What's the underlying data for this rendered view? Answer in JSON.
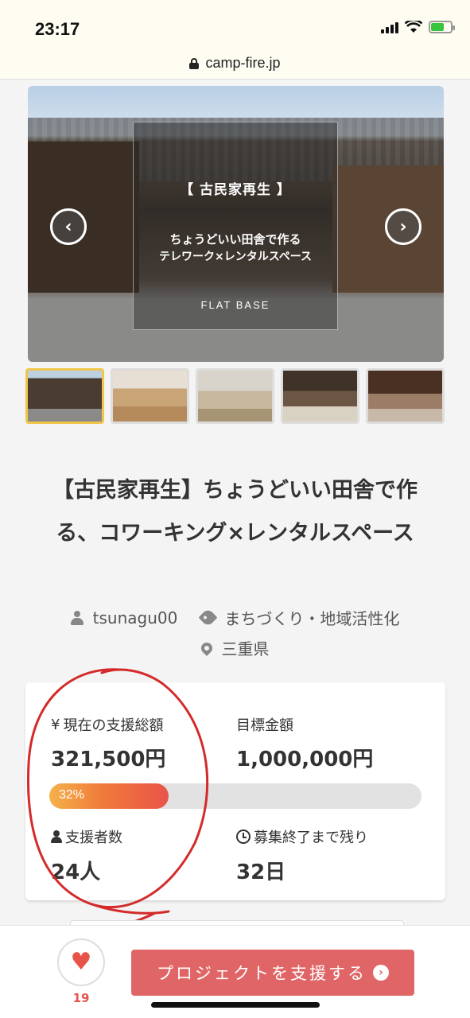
{
  "status": {
    "time": "23:17"
  },
  "browser": {
    "url": "camp-fire.jp"
  },
  "hero": {
    "tag": "【 古民家再生 】",
    "line1": "ちょうどいい田舎で作る",
    "line2": "テレワーク×レンタルスペース",
    "logo": "FLAT BASE",
    "prev_symbol": "‹",
    "next_symbol": "›"
  },
  "project": {
    "title": "【古民家再生】ちょうどいい田舎で作る、コワーキング×レンタルスペース",
    "owner": "tsunagu00",
    "category": "まちづくり・地域活性化",
    "location": "三重県"
  },
  "stats": {
    "current_label": "現在の支援総額",
    "current_prefix": "¥",
    "current_value": "321,500円",
    "goal_label": "目標金額",
    "goal_value": "1,000,000円",
    "progress_text": "32%",
    "progress_fraction": 0.32,
    "backers_label": "支援者数",
    "backers_value": "24人",
    "remaining_label": "募集終了まで残り",
    "remaining_value": "32日"
  },
  "actions": {
    "favorite_count": "19",
    "support_label": "プロジェクトを支援する",
    "support_arrow": "›"
  },
  "colors": {
    "accent": "#e06566",
    "annotation": "#d42a2a",
    "thumb_active": "#f0c64a"
  },
  "icons": [
    "lock-icon",
    "chevron-left-icon",
    "chevron-right-icon",
    "user-icon",
    "tag-icon",
    "pin-icon",
    "person-icon",
    "clock-icon",
    "heart-icon",
    "circle-arrow-icon"
  ]
}
